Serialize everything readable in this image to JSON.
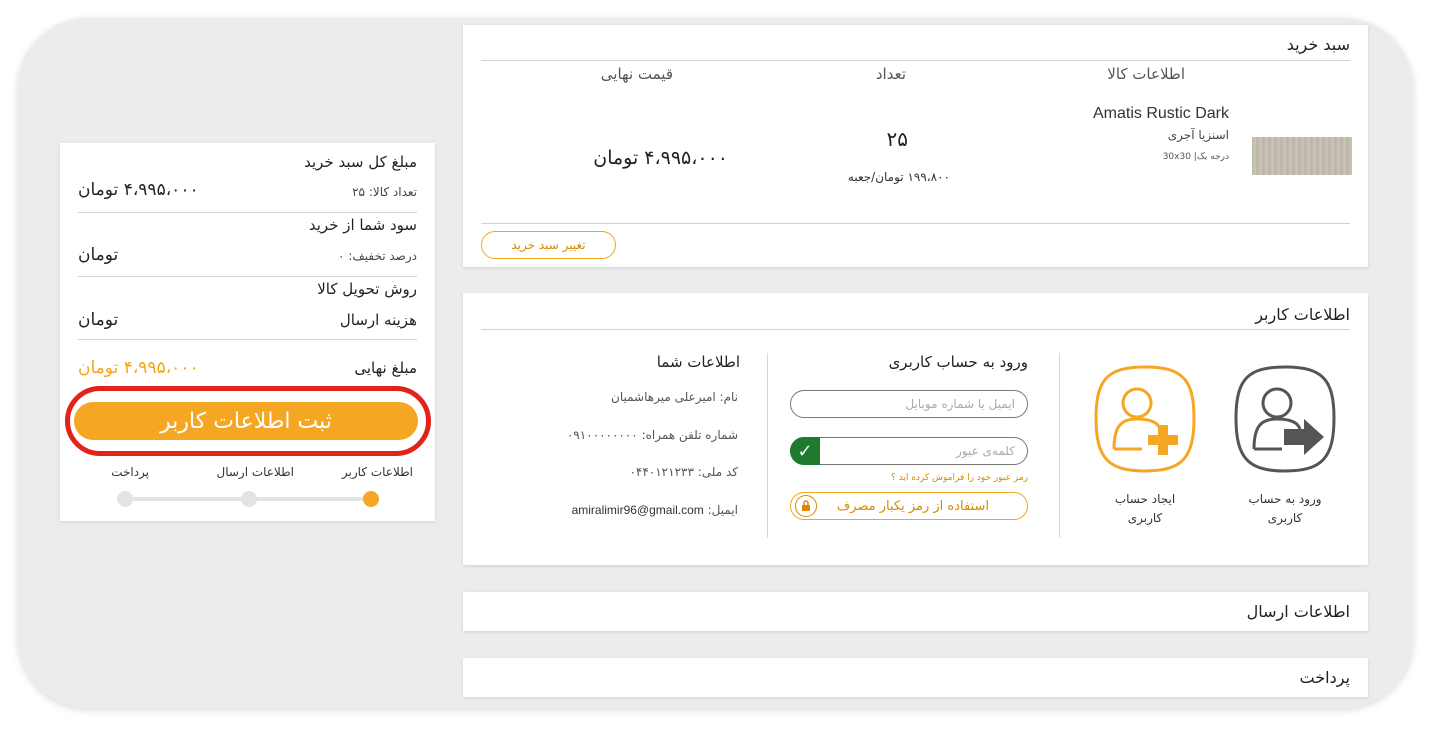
{
  "cart": {
    "title": "سبد خرید",
    "columns": {
      "product": "اطلاعات کالا",
      "qty": "تعداد",
      "final": "قیمت نهایی"
    },
    "item": {
      "name": "Amatis Rustic Dark",
      "type": "اسنزیا آجری",
      "grade": "درجه یک| 30x30",
      "qty": "۲۵",
      "unit_price": "۱۹۹،۸۰۰ تومان/جعبه",
      "total": "۴،۹۹۵،۰۰۰  تومان"
    },
    "change_button": "تغییر سبد خرید"
  },
  "user": {
    "title": "اطلاعات کاربر",
    "login_tile": {
      "line1": "ورود به حساب",
      "line2": "کاربری"
    },
    "create_tile": {
      "line1": "ایجاد حساب",
      "line2": "کاربری"
    },
    "login_form": {
      "title": "ورود به حساب کاربری",
      "email_placeholder": "ایمیل یا شماره موبایل",
      "password_placeholder": "کلمه‌ی عبور",
      "forgot": "رمز عبور خود را فراموش کرده اید ؟",
      "otp_button": "استفاده از رمز یکبار مصرف"
    },
    "your_info": {
      "title": "اطلاعات شما",
      "name": "نام: امیرعلی میرهاشمیان",
      "phone": "شماره تلفن همراه: ۰۹۱۰۰۰۰۰۰۰۰",
      "national_id": "کد ملی: ۰۴۴۰۱۲۱۲۳۳",
      "email_label": "ایمیل:",
      "email": "amiralimir96@gmail.com"
    }
  },
  "shipping": {
    "title": "اطلاعات ارسال"
  },
  "payment": {
    "title": "پرداخت"
  },
  "summary": {
    "cart_total_label": "مبلغ کل سبد خرید",
    "item_count": "تعداد کالا: ۲۵",
    "cart_total_value": "۴،۹۹۵،۰۰۰  تومان",
    "profit_label": "سود شما از خرید",
    "discount": "درصد تخفیف: ۰",
    "profit_value": "تومان",
    "delivery_method": "روش تحویل کالا",
    "shipping_cost_label": "هزینه ارسال",
    "shipping_cost_value": "تومان",
    "final_label": "مبلغ نهایی",
    "final_value": "۴،۹۹۵،۰۰۰  تومان",
    "submit_button": "ثبت اطلاعات کاربر",
    "steps": [
      "اطلاعات کاربر",
      "اطلاعات ارسال",
      "پرداخت"
    ],
    "progress_active_step": 1
  },
  "colors": {
    "accent": "#f5a623",
    "highlight_ring": "#e2231a",
    "check_green": "#1f7a2e"
  }
}
